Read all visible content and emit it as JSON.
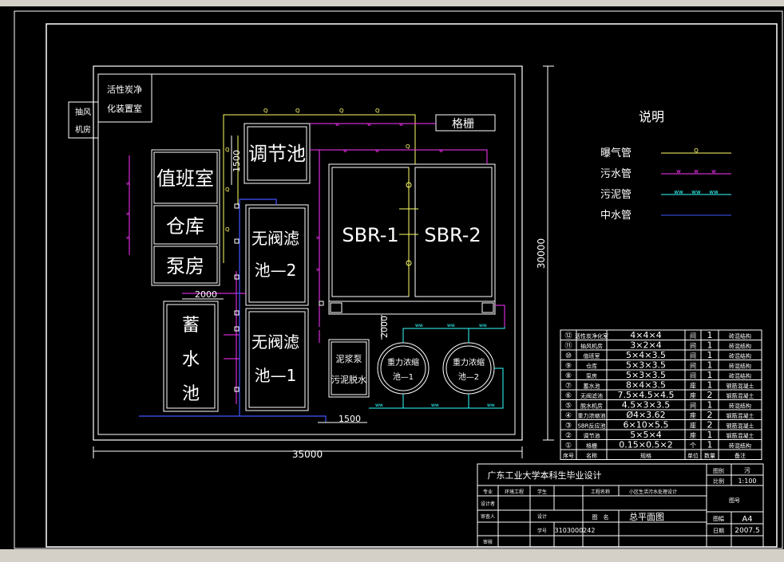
{
  "rooms": {
    "activated_carbon": [
      "活性炭净",
      "化装置室"
    ],
    "exhaust_fan": [
      "抽风",
      "机房"
    ],
    "duty_room": "值班室",
    "warehouse": "仓库",
    "pump_room": "泵房",
    "storage_tank": [
      "蓄",
      "水",
      "池"
    ],
    "regulating_tank": "调节池",
    "filter2": [
      "无阀滤",
      "池—2"
    ],
    "filter1": [
      "无阀滤",
      "池—1"
    ],
    "sbr1": "SBR-1",
    "sbr2": "SBR-2",
    "sludge_pump": [
      "泥浆泵",
      "污泥脱水"
    ],
    "thickener1": [
      "重力浓缩",
      "池—1"
    ],
    "thickener2": [
      "重力浓缩",
      "池—2"
    ],
    "grille": "格栅"
  },
  "dimensions": {
    "overall_width": "35000",
    "overall_height": "30000",
    "d1500_vertical": "1500",
    "d2000_horizontal": "2000",
    "d2000_vertical": "2000",
    "d1500_bottom": "1500"
  },
  "pipe_tag": "Q",
  "legend": {
    "title": "说明",
    "items": [
      {
        "label": "曝气管",
        "color": "#ffff66",
        "tag": "Q"
      },
      {
        "label": "污水管",
        "color": "#ff33ff",
        "tag": "w"
      },
      {
        "label": "污泥管",
        "color": "#33ffff",
        "tag": "ww"
      },
      {
        "label": "中水管",
        "color": "#4455ff",
        "tag": ""
      }
    ]
  },
  "schedule": {
    "rows": [
      {
        "no": "⑫",
        "name": "活性炭净化室",
        "size": "4×4×4",
        "unit": "间",
        "qty": "1",
        "note": "砖混结构"
      },
      {
        "no": "⑪",
        "name": "抽风机房",
        "size": "3×2×4",
        "unit": "间",
        "qty": "1",
        "note": "砖混结构"
      },
      {
        "no": "⑩",
        "name": "值班室",
        "size": "5×4×3.5",
        "unit": "间",
        "qty": "1",
        "note": "砖混结构"
      },
      {
        "no": "⑨",
        "name": "仓库",
        "size": "5×3×3.5",
        "unit": "间",
        "qty": "1",
        "note": "砖混结构"
      },
      {
        "no": "⑧",
        "name": "泵房",
        "size": "5×3×3.5",
        "unit": "间",
        "qty": "1",
        "note": "砖混结构"
      },
      {
        "no": "⑦",
        "name": "蓄水池",
        "size": "8×4×3.5",
        "unit": "座",
        "qty": "1",
        "note": "钢筋混凝土"
      },
      {
        "no": "⑥",
        "name": "无阀滤池",
        "size": "7.5×4.5×4.5",
        "unit": "座",
        "qty": "2",
        "note": "钢筋混凝土"
      },
      {
        "no": "⑤",
        "name": "脱水机房",
        "size": "4.5×3×3.5",
        "unit": "间",
        "qty": "1",
        "note": "砖混结构"
      },
      {
        "no": "④",
        "name": "重力浓缩池",
        "size": "Ø4×3.62",
        "unit": "座",
        "qty": "2",
        "note": "钢筋混凝土"
      },
      {
        "no": "③",
        "name": "SBR反应池",
        "size": "6×10×5.5",
        "unit": "座",
        "qty": "2",
        "note": "钢筋混凝土"
      },
      {
        "no": "②",
        "name": "调节池",
        "size": "5×5×4",
        "unit": "座",
        "qty": "1",
        "note": "钢筋混凝土"
      },
      {
        "no": "①",
        "name": "格栅",
        "size": "0.15×0.5×2",
        "unit": "个",
        "qty": "1",
        "note": "砖混结构"
      }
    ],
    "header": {
      "no": "序号",
      "name": "名称",
      "size": "规格",
      "unit": "单位",
      "qty": "数量",
      "note": "备注"
    }
  },
  "title_block": {
    "school": "广东工业大学本科生毕业设计",
    "pollution_label": "图别",
    "pollution_value": "污",
    "scale_label": "比例",
    "scale_value": "1:100",
    "major_label": "专业",
    "major_value": "环境工程",
    "student_label": "学生",
    "project_name_label": "工程名称",
    "project_name_value": "小区生活污水处理设计",
    "design_label": "设计",
    "drawing_name_label": "图　名",
    "drawing_name_value": "总平面图",
    "check_label": "审核",
    "student_id_label": "学号",
    "student_id_value": "3103000242",
    "designer_label": "设计者",
    "reviewer_label": "审查人",
    "number_label": "图号",
    "size_label": "图幅",
    "size_value": "A4",
    "date_label": "日期",
    "date_value": "2007.5"
  }
}
